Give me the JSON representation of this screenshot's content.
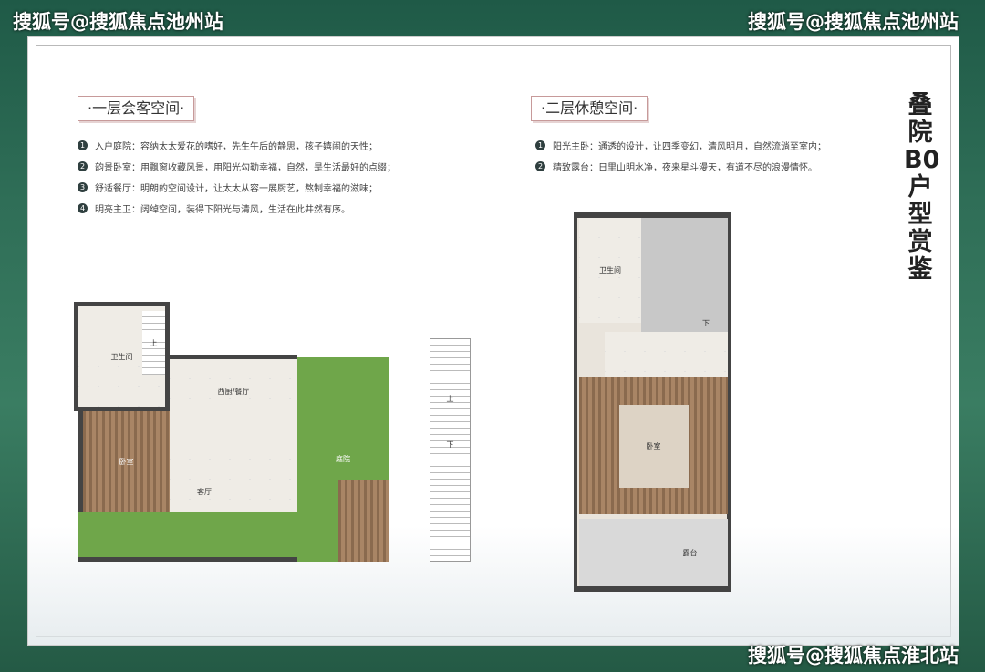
{
  "watermarks": {
    "top_left": "搜狐号@搜狐焦点池州站",
    "top_right": "搜狐号@搜狐焦点池州站",
    "bottom_right": "搜狐号@搜狐焦点淮北站"
  },
  "vertical_title": "叠院B0户型赏鉴",
  "floor1": {
    "tag": "·一层会客空间·",
    "items": [
      {
        "n": "1",
        "text": "入户庭院：容纳太太爱花的嗜好，先生午后的静思，孩子嬉闹的天性；"
      },
      {
        "n": "2",
        "text": "韵景卧室：用飘窗收藏风景，用阳光勾勒幸福，自然，是生活最好的点缀；"
      },
      {
        "n": "3",
        "text": "舒适餐厅：明朗的空间设计，让太太从容一展厨艺，熬制幸福的滋味；"
      },
      {
        "n": "4",
        "text": "明亮主卫：阔绰空间，装得下阳光与清风，生活在此井然有序。"
      }
    ],
    "rooms": {
      "bath": "卫生间",
      "bedroom": "卧室",
      "living": "客厅",
      "dining": "西厨/餐厅",
      "garden": "庭院",
      "up": "上",
      "up2": "上",
      "down": "下"
    }
  },
  "floor2": {
    "tag": "·二层休憩空间·",
    "items": [
      {
        "n": "1",
        "text": "阳光主卧：通透的设计，让四季变幻，清风明月，自然流淌至室内；"
      },
      {
        "n": "2",
        "text": "精致露台：日里山明水净，夜来星斗漫天，有道不尽的浪漫情怀。"
      }
    ],
    "rooms": {
      "bath": "卫生间",
      "bedroom": "卧室",
      "terrace": "露台",
      "down": "下"
    }
  }
}
